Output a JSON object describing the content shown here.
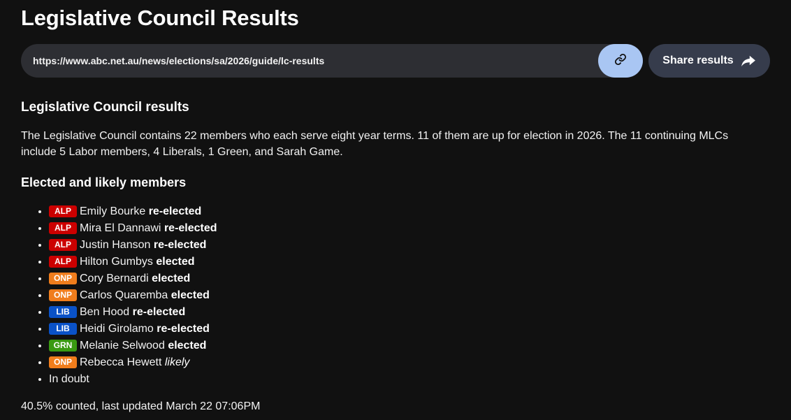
{
  "page": {
    "title": "Legislative Council Results"
  },
  "share_bar": {
    "url": "https://www.abc.net.au/news/elections/sa/2026/guide/lc-results",
    "copy_icon": "link-icon",
    "share_label": "Share results",
    "share_icon": "share-arrow-icon"
  },
  "section": {
    "title": "Legislative Council results",
    "intro": "The Legislative Council contains 22 members who each serve eight year terms. 11 of them are up for election in 2026. The 11 continuing MLCs include 5 Labor members, 4 Liberals, 1 Green, and Sarah Game.",
    "members_title": "Elected and likely members"
  },
  "party_colors": {
    "ALP": "#cc0000",
    "ONP": "#f07d1c",
    "LIB": "#0a52c8",
    "GRN": "#3a9a12"
  },
  "members": [
    {
      "party": "ALP",
      "name": "Emily Bourke",
      "status": "re-elected",
      "italic": false
    },
    {
      "party": "ALP",
      "name": "Mira El Dannawi",
      "status": "re-elected",
      "italic": false
    },
    {
      "party": "ALP",
      "name": "Justin Hanson",
      "status": "re-elected",
      "italic": false
    },
    {
      "party": "ALP",
      "name": "Hilton Gumbys",
      "status": "elected",
      "italic": false
    },
    {
      "party": "ONP",
      "name": "Cory Bernardi",
      "status": "elected",
      "italic": false
    },
    {
      "party": "ONP",
      "name": "Carlos Quaremba",
      "status": "elected",
      "italic": false
    },
    {
      "party": "LIB",
      "name": "Ben Hood",
      "status": "re-elected",
      "italic": false
    },
    {
      "party": "LIB",
      "name": "Heidi Girolamo",
      "status": "re-elected",
      "italic": false
    },
    {
      "party": "GRN",
      "name": "Melanie Selwood",
      "status": "elected",
      "italic": false
    },
    {
      "party": "ONP",
      "name": "Rebecca Hewett",
      "status": "likely",
      "italic": true
    },
    {
      "party": "",
      "name": "In doubt",
      "status": "",
      "italic": false
    }
  ],
  "footer": {
    "status_text": "40.5% counted, last updated March 22 07:06PM"
  }
}
